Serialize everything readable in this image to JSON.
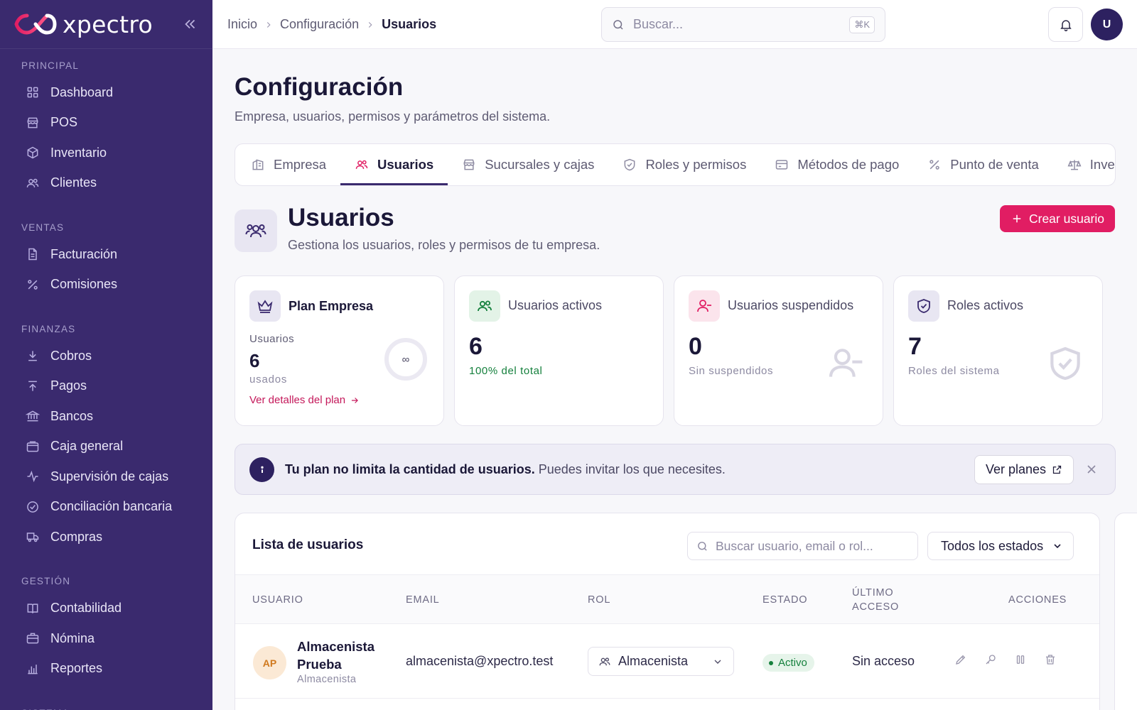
{
  "brand": {
    "name": "xpectro"
  },
  "sidebar": {
    "sections": [
      {
        "title": "PRINCIPAL",
        "items": [
          {
            "label": "Dashboard",
            "icon": "grid-icon"
          },
          {
            "label": "POS",
            "icon": "store-icon"
          },
          {
            "label": "Inventario",
            "icon": "box-icon"
          },
          {
            "label": "Clientes",
            "icon": "users-icon"
          }
        ]
      },
      {
        "title": "VENTAS",
        "items": [
          {
            "label": "Facturación",
            "icon": "file-icon"
          },
          {
            "label": "Comisiones",
            "icon": "percent-icon"
          }
        ]
      },
      {
        "title": "FINANZAS",
        "items": [
          {
            "label": "Cobros",
            "icon": "download-icon"
          },
          {
            "label": "Pagos",
            "icon": "upload-icon"
          },
          {
            "label": "Bancos",
            "icon": "bank-icon"
          },
          {
            "label": "Caja general",
            "icon": "wallet-icon"
          },
          {
            "label": "Supervisión de cajas",
            "icon": "activity-icon"
          },
          {
            "label": "Conciliación bancaria",
            "icon": "check-circle-icon"
          },
          {
            "label": "Compras",
            "icon": "truck-icon"
          }
        ]
      },
      {
        "title": "GESTIÓN",
        "items": [
          {
            "label": "Contabilidad",
            "icon": "book-icon"
          },
          {
            "label": "Nómina",
            "icon": "briefcase-icon"
          },
          {
            "label": "Reportes",
            "icon": "bar-chart-icon"
          }
        ]
      },
      {
        "title": "SISTEMA",
        "items": []
      }
    ]
  },
  "topbar": {
    "breadcrumbs": [
      "Inicio",
      "Configuración",
      "Usuarios"
    ],
    "search_placeholder": "Buscar...",
    "search_shortcut": "⌘K",
    "avatar_initial": "U"
  },
  "page": {
    "title": "Configuración",
    "subtitle": "Empresa, usuarios, permisos y parámetros del sistema."
  },
  "tabs": [
    {
      "label": "Empresa",
      "icon": "building-icon",
      "active": false
    },
    {
      "label": "Usuarios",
      "icon": "users-icon",
      "active": true
    },
    {
      "label": "Sucursales y cajas",
      "icon": "store-icon",
      "active": false
    },
    {
      "label": "Roles y permisos",
      "icon": "shield-check-icon",
      "active": false
    },
    {
      "label": "Métodos de pago",
      "icon": "credit-card-icon",
      "active": false
    },
    {
      "label": "Punto de venta",
      "icon": "percent-icon",
      "active": false
    },
    {
      "label": "Inventario",
      "icon": "scale-icon",
      "active": false
    }
  ],
  "section": {
    "title": "Usuarios",
    "subtitle": "Gestiona los usuarios, roles y permisos de tu empresa.",
    "create_button": "Crear usuario"
  },
  "plan_card": {
    "title": "Plan Empresa",
    "label": "Usuarios",
    "count": "6",
    "used_label": "usados",
    "limit_symbol": "∞",
    "link": "Ver detalles del plan"
  },
  "stats": [
    {
      "title": "Usuarios activos",
      "value": "6",
      "note": "100% del total",
      "note_color": "#15803d",
      "icon_bg": "#e3f3e7",
      "icon_color": "#15803d",
      "icon": "users-icon"
    },
    {
      "title": "Usuarios suspendidos",
      "value": "0",
      "note": "Sin suspendidos",
      "note_color": "#8d8aa2",
      "icon_bg": "#fbe4ec",
      "icon_color": "#e11d63",
      "icon": "user-minus-icon"
    },
    {
      "title": "Roles activos",
      "value": "7",
      "note": "Roles del sistema",
      "note_color": "#8d8aa2",
      "icon_bg": "#e8e6f2",
      "icon_color": "#3a2a6e",
      "icon": "shield-check-icon"
    }
  ],
  "banner": {
    "bold": "Tu plan no limita la cantidad de usuarios.",
    "text": " Puedes invitar los que necesites.",
    "button": "Ver planes"
  },
  "user_list": {
    "title": "Lista de usuarios",
    "search_placeholder": "Buscar usuario, email o rol...",
    "filter_value": "Todos los estados",
    "columns": [
      "USUARIO",
      "EMAIL",
      "ROL",
      "ESTADO",
      "ÚLTIMO ACCESO",
      "ACCIONES"
    ],
    "rows": [
      {
        "initials": "AP",
        "name": "Almacenista Prueba",
        "role_sub": "Almacenista",
        "email": "almacenista@xpectro.test",
        "role": "Almacenista",
        "status": "Activo",
        "last_access": "Sin acceso"
      }
    ]
  },
  "colors": {
    "sidebar": "#3a2a6e",
    "accent": "#e11d63",
    "primary": "#2d2160"
  }
}
